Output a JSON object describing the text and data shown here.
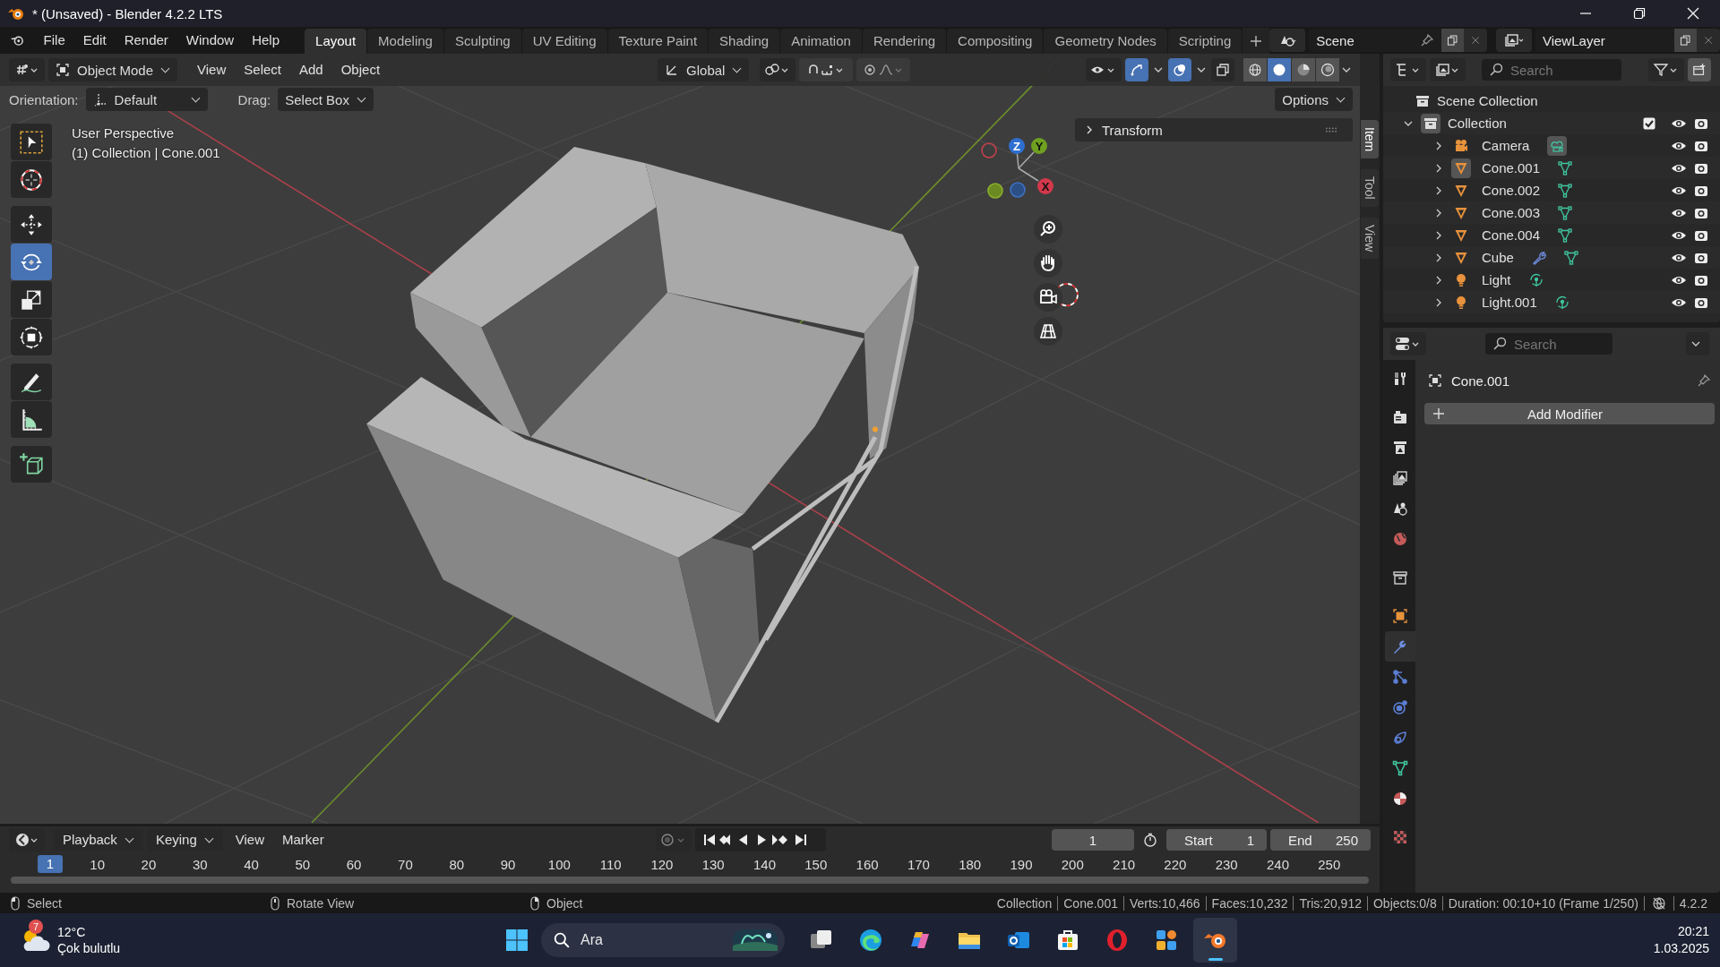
{
  "window": {
    "title": "* (Unsaved) - Blender 4.2.2 LTS"
  },
  "menu": [
    "File",
    "Edit",
    "Render",
    "Window",
    "Help"
  ],
  "workspaces": [
    {
      "label": "Layout",
      "selected": true
    },
    {
      "label": "Modeling",
      "selected": false
    },
    {
      "label": "Sculpting",
      "selected": false
    },
    {
      "label": "UV Editing",
      "selected": false
    },
    {
      "label": "Texture Paint",
      "selected": false
    },
    {
      "label": "Shading",
      "selected": false
    },
    {
      "label": "Animation",
      "selected": false
    },
    {
      "label": "Rendering",
      "selected": false
    },
    {
      "label": "Compositing",
      "selected": false
    },
    {
      "label": "Geometry Nodes",
      "selected": false
    },
    {
      "label": "Scripting",
      "selected": false
    }
  ],
  "scene": {
    "name": "Scene"
  },
  "view_layer": {
    "name": "ViewLayer"
  },
  "viewport": {
    "mode": "Object Mode",
    "menus": [
      "View",
      "Select",
      "Add",
      "Object"
    ],
    "orientation_global": "Global",
    "toggles": {
      "snap": false,
      "proportional_editing": false,
      "gizmos": true,
      "overlays": true,
      "xray": false
    },
    "tool_settings": {
      "orientation_label": "Orientation:",
      "orientation": "Default",
      "drag_label": "Drag:",
      "drag": "Select Box",
      "options": "Options"
    },
    "shading": [
      {
        "kind": "wireframe",
        "selected": false
      },
      {
        "kind": "solid",
        "selected": true
      },
      {
        "kind": "material",
        "selected": false
      },
      {
        "kind": "rendered",
        "selected": false
      }
    ],
    "tools": [
      {
        "kind": "select",
        "selected": false
      },
      {
        "kind": "cursor",
        "selected": false
      },
      {
        "kind": "move",
        "selected": false
      },
      {
        "kind": "rotate",
        "selected": true
      },
      {
        "kind": "scale",
        "selected": false
      },
      {
        "kind": "transform",
        "selected": false
      },
      {
        "kind": "annotate",
        "selected": false
      },
      {
        "kind": "measure",
        "selected": false
      },
      {
        "kind": "add-cube",
        "selected": false
      }
    ],
    "info": [
      "User Perspective",
      "(1) Collection | Cone.001"
    ],
    "gizmo_axes": [
      "Z",
      "Y",
      "X"
    ],
    "sidebar": {
      "panel": "Transform",
      "tabs": [
        {
          "label": "Item",
          "selected": true
        },
        {
          "label": "Tool",
          "selected": false
        },
        {
          "label": "View",
          "selected": false
        }
      ]
    }
  },
  "outliner": {
    "search_placeholder": "Search",
    "root": "Scene Collection",
    "collection": {
      "name": "Collection",
      "expanded": true,
      "checked": true,
      "children": [
        {
          "name": "Camera",
          "kind": "camera",
          "selected": false,
          "has_modifier": false
        },
        {
          "name": "Cone.001",
          "kind": "mesh",
          "selected": true,
          "has_modifier": false
        },
        {
          "name": "Cone.002",
          "kind": "mesh",
          "selected": false,
          "has_modifier": false
        },
        {
          "name": "Cone.003",
          "kind": "mesh",
          "selected": false,
          "has_modifier": false
        },
        {
          "name": "Cone.004",
          "kind": "mesh",
          "selected": false,
          "has_modifier": false
        },
        {
          "name": "Cube",
          "kind": "mesh",
          "selected": false,
          "has_modifier": true
        },
        {
          "name": "Light",
          "kind": "light",
          "selected": false,
          "has_modifier": false
        },
        {
          "name": "Light.001",
          "kind": "light",
          "selected": false,
          "has_modifier": false
        }
      ]
    }
  },
  "properties": {
    "search_placeholder": "Search",
    "object": "Cone.001",
    "add_modifier": "Add Modifier",
    "tabs": [
      {
        "kind": "tool",
        "selected": false
      },
      {
        "kind": "render",
        "selected": false
      },
      {
        "kind": "output",
        "selected": false
      },
      {
        "kind": "view-layer",
        "selected": false
      },
      {
        "kind": "scene",
        "selected": false
      },
      {
        "kind": "world",
        "selected": false
      },
      {
        "kind": "collection",
        "selected": false
      },
      {
        "kind": "object",
        "selected": false
      },
      {
        "kind": "modifier",
        "selected": true
      },
      {
        "kind": "particles",
        "selected": false
      },
      {
        "kind": "physics",
        "selected": false
      },
      {
        "kind": "constraints",
        "selected": false
      },
      {
        "kind": "data",
        "selected": false
      },
      {
        "kind": "material",
        "selected": false
      },
      {
        "kind": "texture",
        "selected": false
      }
    ]
  },
  "timeline": {
    "menus": [
      "Playback",
      "Keying",
      "View",
      "Marker"
    ],
    "auto_keying": false,
    "current_frame": "1",
    "start_label": "Start",
    "start": "1",
    "end_label": "End",
    "end": "250",
    "playhead": "1",
    "ticks": [
      "10",
      "20",
      "30",
      "40",
      "50",
      "60",
      "70",
      "80",
      "90",
      "100",
      "110",
      "120",
      "130",
      "140",
      "150",
      "160",
      "170",
      "180",
      "190",
      "200",
      "210",
      "220",
      "230",
      "240",
      "250"
    ]
  },
  "status_bar": {
    "hints": [
      {
        "kind": "mouse-left",
        "label": "Select"
      },
      {
        "kind": "mouse-middle",
        "label": "Rotate View"
      },
      {
        "kind": "mouse-right",
        "label": "Object"
      }
    ],
    "stats": [
      "Collection",
      "Cone.001",
      "Verts:10,466",
      "Faces:10,232",
      "Tris:20,912",
      "Objects:0/8",
      "Duration: 00:10+10 (Frame 1/250)"
    ],
    "version": "4.2.2"
  },
  "taskbar": {
    "weather": {
      "badge": "7",
      "temperature": "12°C",
      "condition": "Çok bulutlu"
    },
    "search_placeholder": "Ara",
    "apps": [
      {
        "kind": "task-view",
        "active": false
      },
      {
        "kind": "edge",
        "active": false
      },
      {
        "kind": "copilot",
        "active": false
      },
      {
        "kind": "explorer",
        "active": false
      },
      {
        "kind": "outlook",
        "active": false
      },
      {
        "kind": "store",
        "active": false
      },
      {
        "kind": "opera",
        "active": false
      },
      {
        "kind": "app-grid",
        "active": false
      },
      {
        "kind": "blender",
        "active": true
      }
    ],
    "time": "20:21",
    "date": "1.03.2025"
  }
}
